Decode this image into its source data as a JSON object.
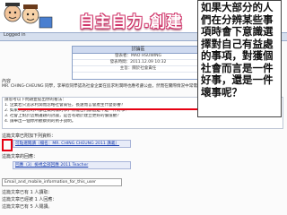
{
  "slide": {
    "title": "自主自力.創建",
    "status": "Logged in"
  },
  "post": {
    "header": "討論區",
    "rows": [
      "發表者：MAO HSUWING",
      "發表時間：2011.12.09 10:32",
      "主旨：關於社會責任"
    ]
  },
  "content": {
    "field_label": "內容",
    "body": "MR. CHING-CHEUNG 同學，李華欣同學認為社會企業在追求利潤時也應考慮公益，然而在實際情況中常需權衡取捨。",
    "question_lines": [
      "請思考以下問題並提出你的看法：",
      "1. 企業若只追求利潤而忽略社會責任，長遠而言會產生什麼影響？",
      "2. 如果大部分的人都在做同樣的事，你能否判斷這是不是一件好事？",
      "3. 社會上對於這類議題的討論，是否有助於建立更好的價值觀？",
      "4. 請舉出一個你所觀察到的例子說明。"
    ]
  },
  "attachments": {
    "label": "這篇文章已附加下列資料：",
    "link1": "可點選閱讀（檔名：MR. CHING CHEUNG 2011 講義）",
    "label2": "這篇文章的回應：",
    "link2": "回應（3）檢視全部回應 2011 Teacher",
    "tag": "Email_and_mobile_information_for_this_user",
    "reply1": "這篇文章已有 1 人讀取：",
    "reply2": "這篇文章已經被 1 人回應：",
    "reply3": "這篇文章已有 5 人閱讀。"
  },
  "callout": {
    "text": "如果大部分的人們在分辨某些事項時會下意識選擇對自己有益處的事項，對獲個社會而言是一件好事，還是一件壞事呢？"
  },
  "colors": {
    "title_outline": "#d0356a",
    "highlight": "#e60012",
    "link": "#1a3fb0"
  }
}
